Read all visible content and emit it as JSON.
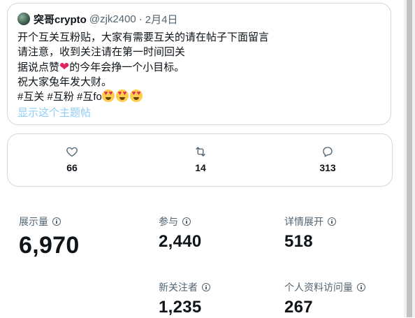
{
  "tweet": {
    "author_name": "突哥crypto",
    "author_handle": "@zjk2400",
    "separator": "·",
    "date": "2月4日",
    "lines": [
      "开个互关互粉贴，大家有需要互关的请在帖子下面留言",
      "请注意，收到关注请在第一时间回关"
    ],
    "line3_before": "据说点赞",
    "heart_emoji": "❤",
    "line3_after": "的今年会挣一个小目标。",
    "line4": "祝大家兔年发大财。",
    "hashtags": "#互关 #互粉 #互fo",
    "show_thread_label": "显示这个主题帖"
  },
  "engagement": {
    "likes": {
      "icon": "heart-outline-icon",
      "count": "66"
    },
    "reposts": {
      "icon": "retweet-icon",
      "count": "14"
    },
    "replies": {
      "icon": "reply-bubble-icon",
      "count": "313"
    }
  },
  "stats": {
    "impressions": {
      "label": "展示量",
      "value": "6,970"
    },
    "engagements": {
      "label": "参与",
      "value": "2,440"
    },
    "detail_expands": {
      "label": "详情展开",
      "value": "518"
    },
    "new_followers": {
      "label": "新关注者",
      "value": "1,235"
    },
    "profile_visits": {
      "label": "个人资料访问量",
      "value": "267"
    }
  },
  "colors": {
    "text_primary": "#0f1419",
    "text_secondary": "#536471",
    "border": "#cfd9de",
    "link_faded": "#8ecdf7",
    "heart": "#e0245e"
  }
}
